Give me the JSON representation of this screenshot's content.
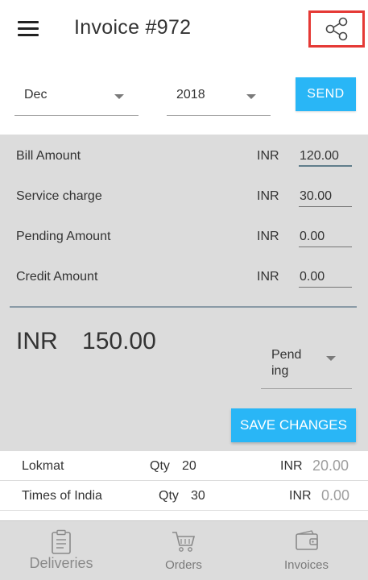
{
  "appbar": {
    "title": "Invoice #972",
    "menu_icon": "hamburger-menu-icon",
    "share_icon": "share-icon",
    "highlight_color": "#e53935"
  },
  "filters": {
    "month": "Dec",
    "year": "2018",
    "send_label": "SEND"
  },
  "amounts": [
    {
      "label": "Bill Amount",
      "currency": "INR",
      "value": "120.00"
    },
    {
      "label": "Service charge",
      "currency": "INR",
      "value": "30.00"
    },
    {
      "label": "Pending Amount",
      "currency": "INR",
      "value": "0.00"
    },
    {
      "label": "Credit Amount",
      "currency": "INR",
      "value": "0.00"
    }
  ],
  "total": {
    "currency": "INR",
    "value": "150.00"
  },
  "status": {
    "selected": "Pending"
  },
  "save_label": "SAVE CHANGES",
  "deliveries": [
    {
      "name": "Lokmat",
      "qty_label": "Qty",
      "qty": "20",
      "currency": "INR",
      "price": "20.00"
    },
    {
      "name": "Times of India",
      "qty_label": "Qty",
      "qty": "30",
      "currency": "INR",
      "price": "0.00"
    }
  ],
  "nav": {
    "deliveries": "Deliveries",
    "orders": "Orders",
    "invoices": "Invoices"
  },
  "colors": {
    "accent": "#29b6f6",
    "card_bg": "#dcdcdc"
  }
}
